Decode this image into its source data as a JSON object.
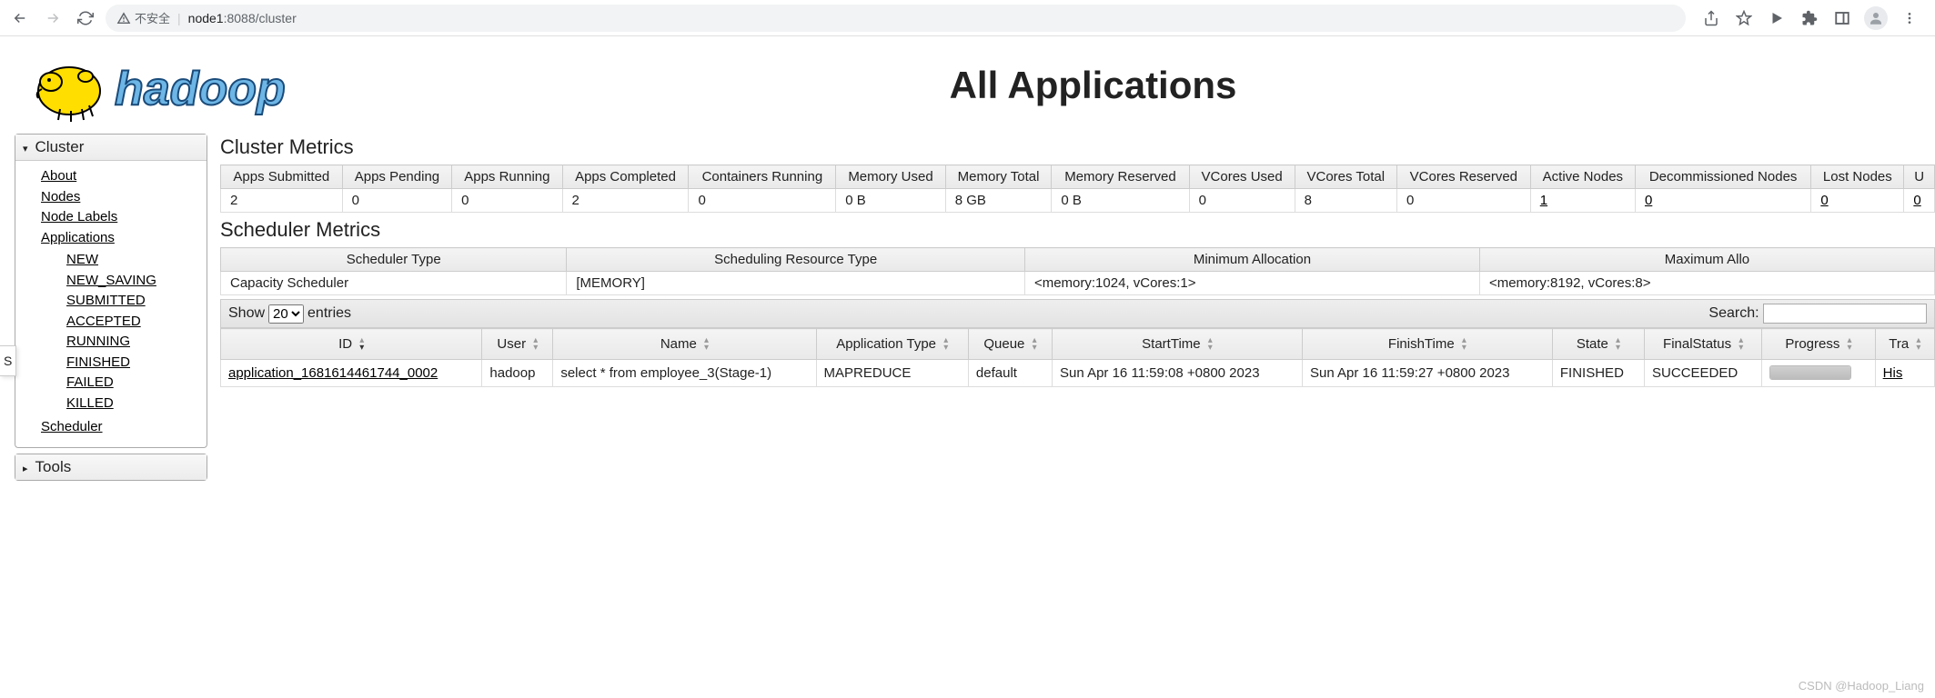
{
  "browser": {
    "insecure_label": "不安全",
    "url_host": "node1",
    "url_rest": ":8088/cluster"
  },
  "page": {
    "title": "All Applications"
  },
  "sidebar": {
    "cluster_label": "Cluster",
    "links": {
      "about": "About",
      "nodes": "Nodes",
      "node_labels": "Node Labels",
      "applications": "Applications",
      "scheduler": "Scheduler"
    },
    "app_states": [
      "NEW",
      "NEW_SAVING",
      "SUBMITTED",
      "ACCEPTED",
      "RUNNING",
      "FINISHED",
      "FAILED",
      "KILLED"
    ],
    "tools_label": "Tools"
  },
  "cluster_metrics": {
    "title": "Cluster Metrics",
    "headers": [
      "Apps Submitted",
      "Apps Pending",
      "Apps Running",
      "Apps Completed",
      "Containers Running",
      "Memory Used",
      "Memory Total",
      "Memory Reserved",
      "VCores Used",
      "VCores Total",
      "VCores Reserved",
      "Active Nodes",
      "Decommissioned Nodes",
      "Lost Nodes",
      "U"
    ],
    "values": [
      "2",
      "0",
      "0",
      "2",
      "0",
      "0 B",
      "8 GB",
      "0 B",
      "0",
      "8",
      "0",
      "1",
      "0",
      "0",
      "0"
    ],
    "link_cols": [
      11,
      12,
      13,
      14
    ]
  },
  "scheduler_metrics": {
    "title": "Scheduler Metrics",
    "headers": [
      "Scheduler Type",
      "Scheduling Resource Type",
      "Minimum Allocation",
      "Maximum Allo"
    ],
    "values": [
      "Capacity Scheduler",
      "[MEMORY]",
      "<memory:1024, vCores:1>",
      "<memory:8192, vCores:8>"
    ]
  },
  "datatable": {
    "show_label": "Show",
    "entries_label": "entries",
    "page_size": "20",
    "search_label": "Search:",
    "headers": [
      "ID",
      "User",
      "Name",
      "Application Type",
      "Queue",
      "StartTime",
      "FinishTime",
      "State",
      "FinalStatus",
      "Progress",
      "Tra"
    ],
    "rows": [
      {
        "id": "application_1681614461744_0002",
        "user": "hadoop",
        "name": "select * from employee_3(Stage-1)",
        "type": "MAPREDUCE",
        "queue": "default",
        "start": "Sun Apr 16 11:59:08 +0800 2023",
        "finish": "Sun Apr 16 11:59:27 +0800 2023",
        "state": "FINISHED",
        "final": "SUCCEEDED",
        "progress": 100,
        "track": "His"
      }
    ]
  },
  "watermark": "CSDN @Hadoop_Liang",
  "tab_stub": "S"
}
